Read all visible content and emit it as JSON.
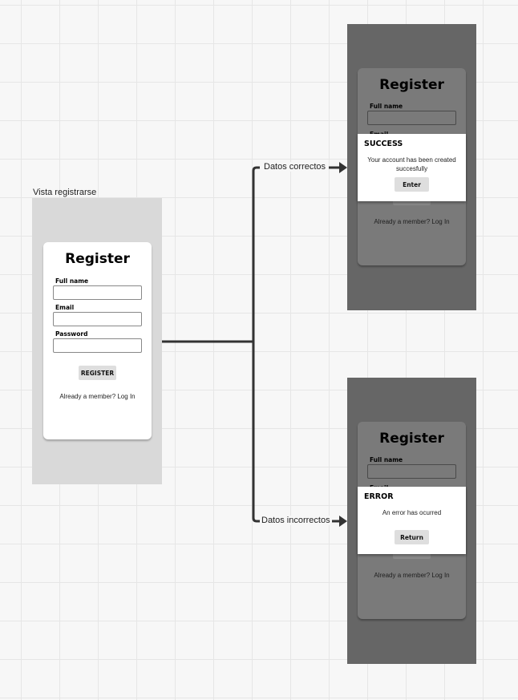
{
  "frame_label": "Vista registrarse",
  "register": {
    "title": "Register",
    "full_name_label": "Full name",
    "email_label": "Email",
    "password_label": "Password",
    "button_label": "REGISTER",
    "member_text": "Already a member? Log In"
  },
  "success_screen": {
    "title": "Register",
    "full_name_label": "Full name",
    "email_label_partial": "Email",
    "member_text": "Already a member? Log In",
    "modal": {
      "title": "SUCCESS",
      "message": "Your account has been created succesfully",
      "button_label": "Enter"
    }
  },
  "error_screen": {
    "title": "Register",
    "full_name_label": "Full name",
    "email_label_partial": "Email",
    "member_text": "Already a member? Log In",
    "modal": {
      "title": "ERROR",
      "message": "An error has ocurred",
      "button_label": "Return"
    }
  },
  "connectors": {
    "correct_label": "Datos correctos",
    "incorrect_label": "Datos incorrectos"
  },
  "colors": {
    "frame_light": "#d9d9d9",
    "frame_dark": "#666666",
    "connector": "#333333"
  }
}
